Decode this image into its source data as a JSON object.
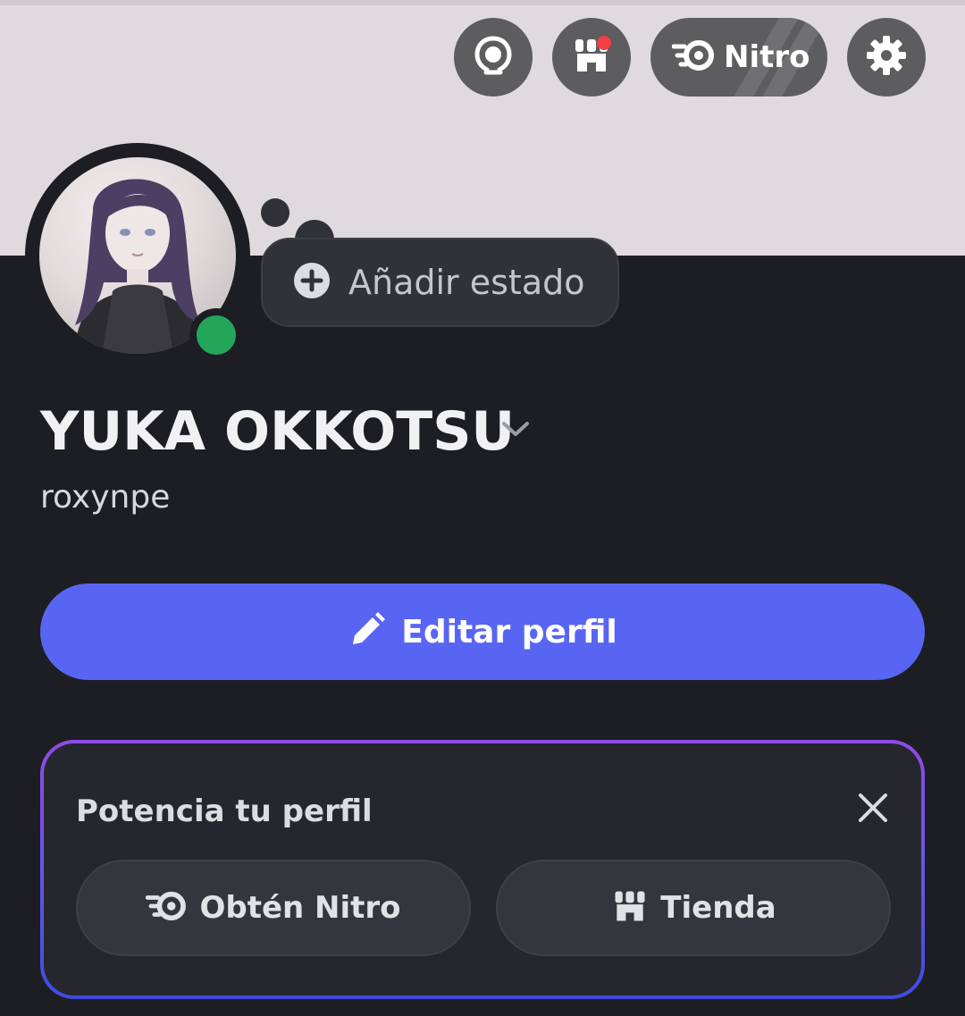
{
  "header": {
    "nitro_label": "Nitro",
    "icons": [
      "laurel-icon",
      "shop-icon",
      "nitro-icon",
      "gear-icon"
    ],
    "shop_notification": true
  },
  "profile": {
    "status_bubble_label": "Añadir estado",
    "display_name": "YUKA OKKOTSU",
    "username": "roxynpe",
    "presence": "online"
  },
  "actions": {
    "edit_profile_label": "Editar perfil"
  },
  "boost_card": {
    "title": "Potencia tu perfil",
    "nitro_button_label": "Obtén Nitro",
    "shop_button_label": "Tienda"
  },
  "colors": {
    "background": "#1d1e23",
    "banner": "#dfdadd",
    "accent_blurple": "#5865f2",
    "online_green": "#23a55a",
    "notification_red": "#f23f43",
    "card_gradient_top": "#8e4be8",
    "card_gradient_bottom": "#3f4be0"
  }
}
